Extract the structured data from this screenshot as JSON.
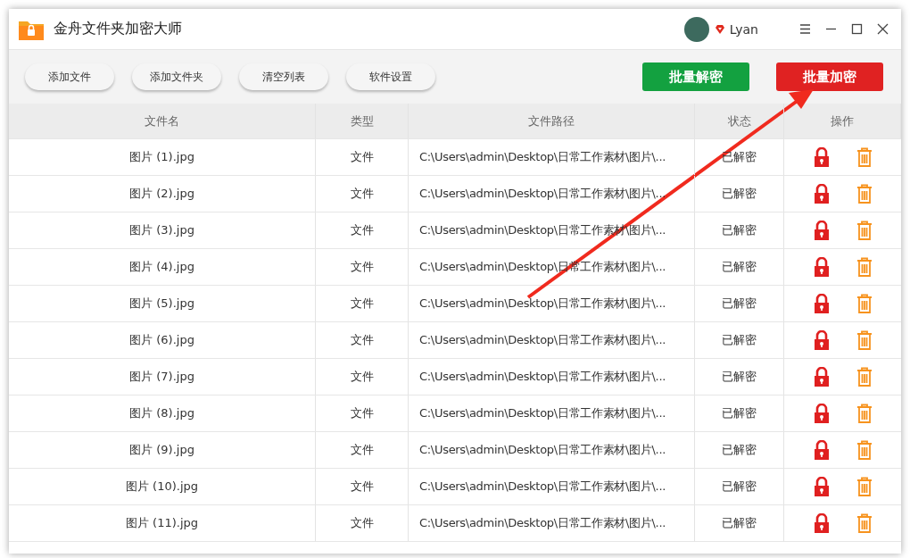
{
  "window": {
    "title": "金舟文件夹加密大师",
    "user": "Lyan"
  },
  "toolbar": {
    "buttons": [
      {
        "label": "添加文件",
        "kind": "plain"
      },
      {
        "label": "添加文件夹",
        "kind": "plain"
      },
      {
        "label": "清空列表",
        "kind": "plain"
      },
      {
        "label": "软件设置",
        "kind": "plain"
      },
      {
        "label": "批量解密",
        "kind": "decrypt"
      },
      {
        "label": "批量加密",
        "kind": "encrypt"
      }
    ]
  },
  "table": {
    "columns": [
      "文件名",
      "类型",
      "文件路径",
      "状态",
      "操作"
    ],
    "rows": [
      {
        "name": "图片 (1).jpg",
        "type": "文件",
        "path": "C:\\Users\\admin\\Desktop\\日常工作素材\\图片\\...",
        "status": "已解密"
      },
      {
        "name": "图片 (2).jpg",
        "type": "文件",
        "path": "C:\\Users\\admin\\Desktop\\日常工作素材\\图片\\...",
        "status": "已解密"
      },
      {
        "name": "图片 (3).jpg",
        "type": "文件",
        "path": "C:\\Users\\admin\\Desktop\\日常工作素材\\图片\\...",
        "status": "已解密"
      },
      {
        "name": "图片 (4).jpg",
        "type": "文件",
        "path": "C:\\Users\\admin\\Desktop\\日常工作素材\\图片\\...",
        "status": "已解密"
      },
      {
        "name": "图片 (5).jpg",
        "type": "文件",
        "path": "C:\\Users\\admin\\Desktop\\日常工作素材\\图片\\...",
        "status": "已解密"
      },
      {
        "name": "图片 (6).jpg",
        "type": "文件",
        "path": "C:\\Users\\admin\\Desktop\\日常工作素材\\图片\\...",
        "status": "已解密"
      },
      {
        "name": "图片 (7).jpg",
        "type": "文件",
        "path": "C:\\Users\\admin\\Desktop\\日常工作素材\\图片\\...",
        "status": "已解密"
      },
      {
        "name": "图片 (8).jpg",
        "type": "文件",
        "path": "C:\\Users\\admin\\Desktop\\日常工作素材\\图片\\...",
        "status": "已解密"
      },
      {
        "name": "图片 (9).jpg",
        "type": "文件",
        "path": "C:\\Users\\admin\\Desktop\\日常工作素材\\图片\\...",
        "status": "已解密"
      },
      {
        "name": "图片 (10).jpg",
        "type": "文件",
        "path": "C:\\Users\\admin\\Desktop\\日常工作素材\\图片\\...",
        "status": "已解密"
      },
      {
        "name": "图片 (11).jpg",
        "type": "文件",
        "path": "C:\\Users\\admin\\Desktop\\日常工作素材\\图片\\...",
        "status": "已解密"
      }
    ]
  }
}
